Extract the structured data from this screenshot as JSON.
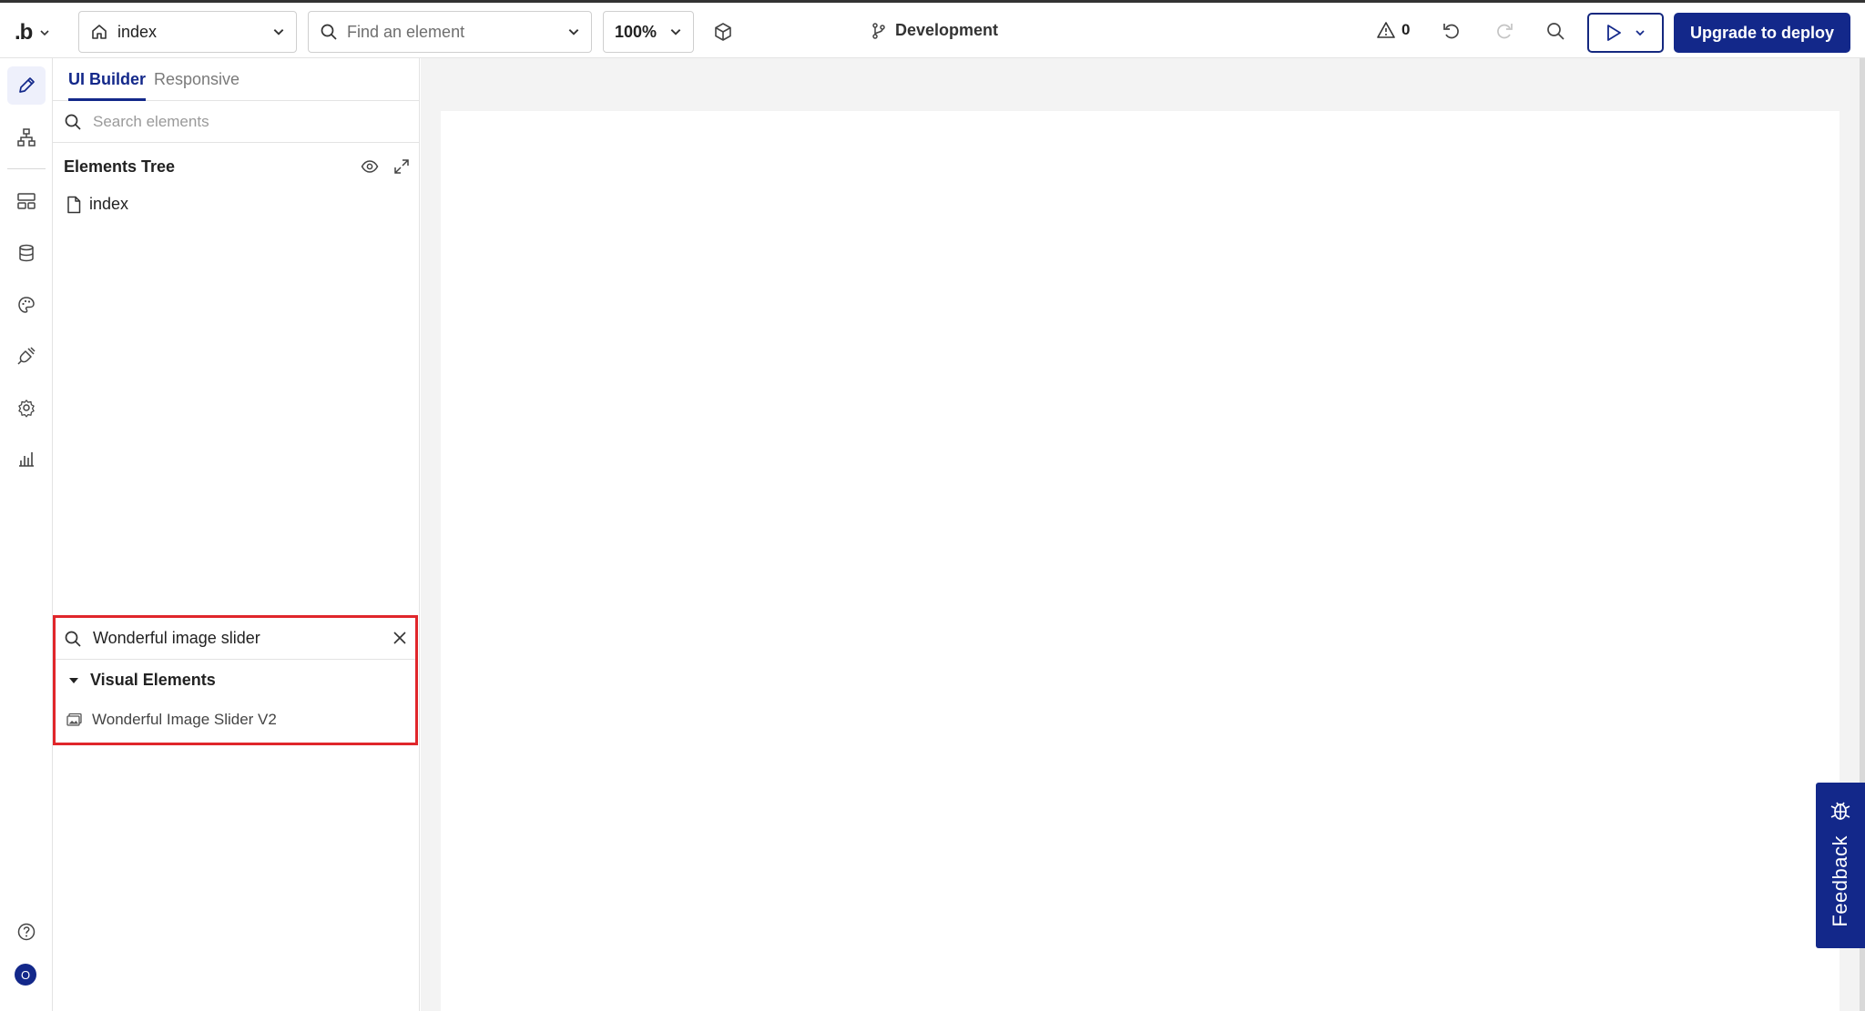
{
  "topbar": {
    "logo": ".b",
    "page_select": "index",
    "find_placeholder": "Find an element",
    "zoom": "100%",
    "branch": "Development",
    "issues_count": "0",
    "upgrade_label": "Upgrade to deploy"
  },
  "panel": {
    "tabs": [
      {
        "label": "UI Builder"
      },
      {
        "label": "Responsive"
      }
    ],
    "search_placeholder": "Search elements",
    "tree_title": "Elements Tree",
    "tree_root": "index"
  },
  "component_search": {
    "query": "Wonderful image slider",
    "group": "Visual Elements",
    "result": "Wonderful Image Slider V2"
  },
  "rail": {
    "avatar_initial": "O"
  },
  "feedback": {
    "label": "Feedback"
  },
  "colors": {
    "accent": "#13288a",
    "highlight": "#e0262b"
  }
}
